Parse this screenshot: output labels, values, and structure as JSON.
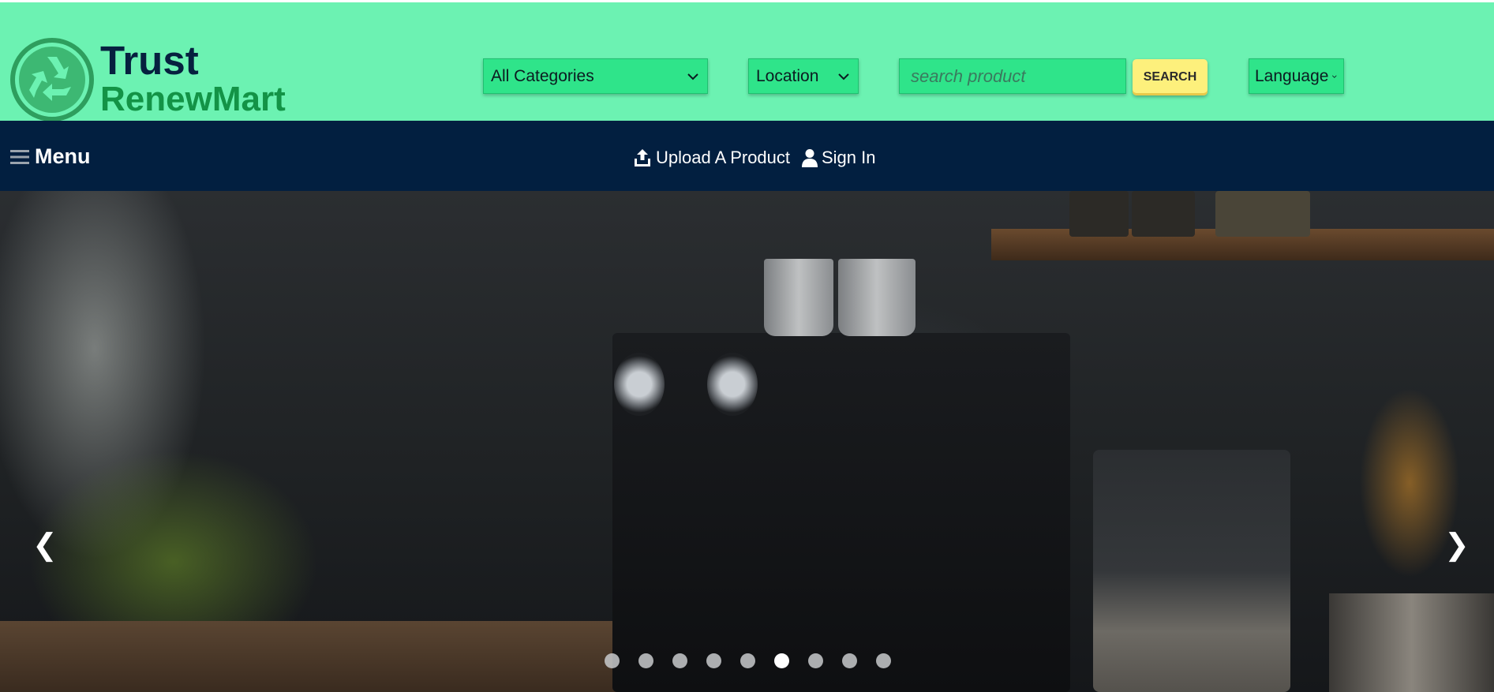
{
  "brand": {
    "line1": "Trust",
    "line2": "RenewMart",
    "logo_icon": "recycle-icon",
    "colors": {
      "dark": "#06203f",
      "green": "#139346"
    }
  },
  "header": {
    "background": "#6cf2b2",
    "category_select": {
      "value": "All Categories"
    },
    "location_select": {
      "value": "Location"
    },
    "search": {
      "placeholder": "search product",
      "value": "",
      "button_label": "SEARCH"
    },
    "language_select": {
      "value": "Language"
    }
  },
  "nav": {
    "background": "#021f40",
    "menu_label": "Menu",
    "menu_icon": "hamburger-icon",
    "upload_label": "Upload A Product",
    "upload_icon": "upload-icon",
    "signin_label": "Sign In",
    "signin_icon": "user-icon"
  },
  "carousel": {
    "prev_glyph": "❮",
    "next_glyph": "❯",
    "slide_count": 9,
    "active_index": 6
  }
}
